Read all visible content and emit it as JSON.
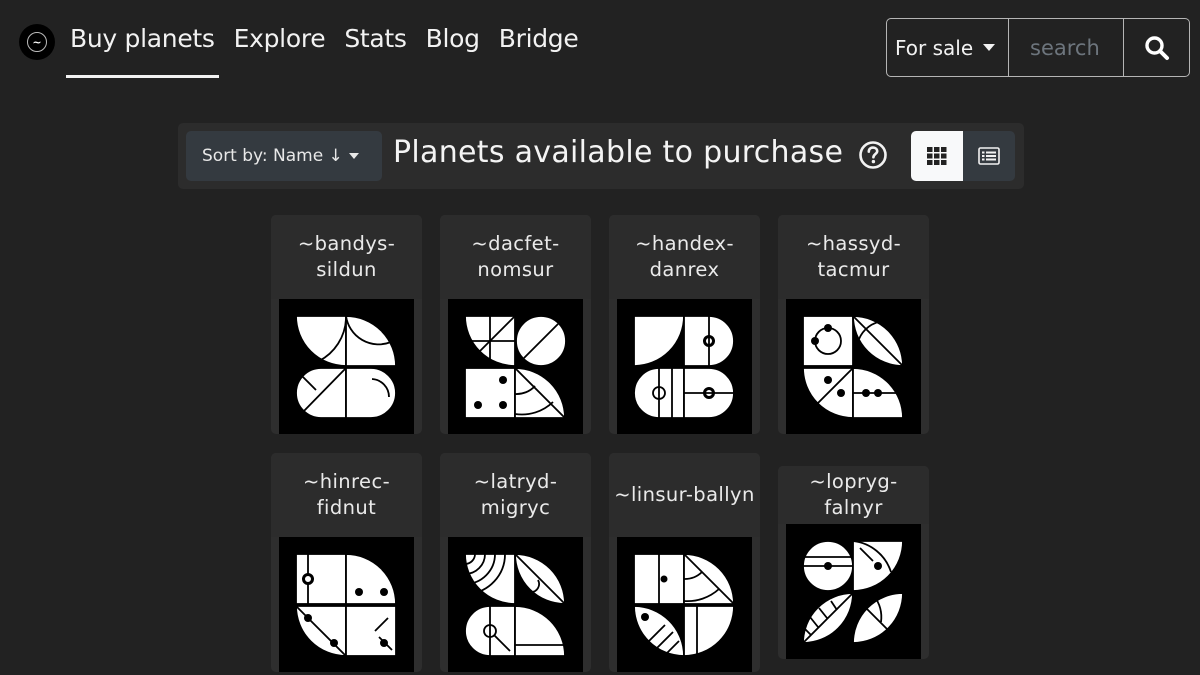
{
  "nav": {
    "logo_icon": "urbit-tilde-logo",
    "items": [
      {
        "label": "Buy planets",
        "active": true
      },
      {
        "label": "Explore",
        "active": false
      },
      {
        "label": "Stats",
        "active": false
      },
      {
        "label": "Blog",
        "active": false
      },
      {
        "label": "Bridge",
        "active": false
      }
    ]
  },
  "search": {
    "filter_selected": "For sale",
    "placeholder": "search",
    "value": "",
    "button_icon": "search-icon"
  },
  "toolbar": {
    "sort_label": "Sort by: Name ↓",
    "title": "Planets available to purchase",
    "help_icon": "question-circle-icon",
    "view_modes": [
      {
        "name": "grid",
        "icon": "grid-icon",
        "active": true
      },
      {
        "name": "list",
        "icon": "list-icon",
        "active": false
      }
    ]
  },
  "planets": [
    {
      "name": "~bandys-sildun"
    },
    {
      "name": "~dacfet-nomsur"
    },
    {
      "name": "~handex-danrex"
    },
    {
      "name": "~hassyd-tacmur"
    },
    {
      "name": "~hinrec-fidnut"
    },
    {
      "name": "~latryd-migryc"
    },
    {
      "name": "~linsur-ballyn"
    },
    {
      "name": "~lopryg-falnyr"
    }
  ],
  "colors": {
    "background": "#222222",
    "card": "#2e2e2e",
    "toolbar": "#2c2c2c",
    "button_dark": "#343a40",
    "button_light": "#f8f9fa",
    "sigil_bg": "#000000",
    "sigil_fg": "#ffffff"
  }
}
